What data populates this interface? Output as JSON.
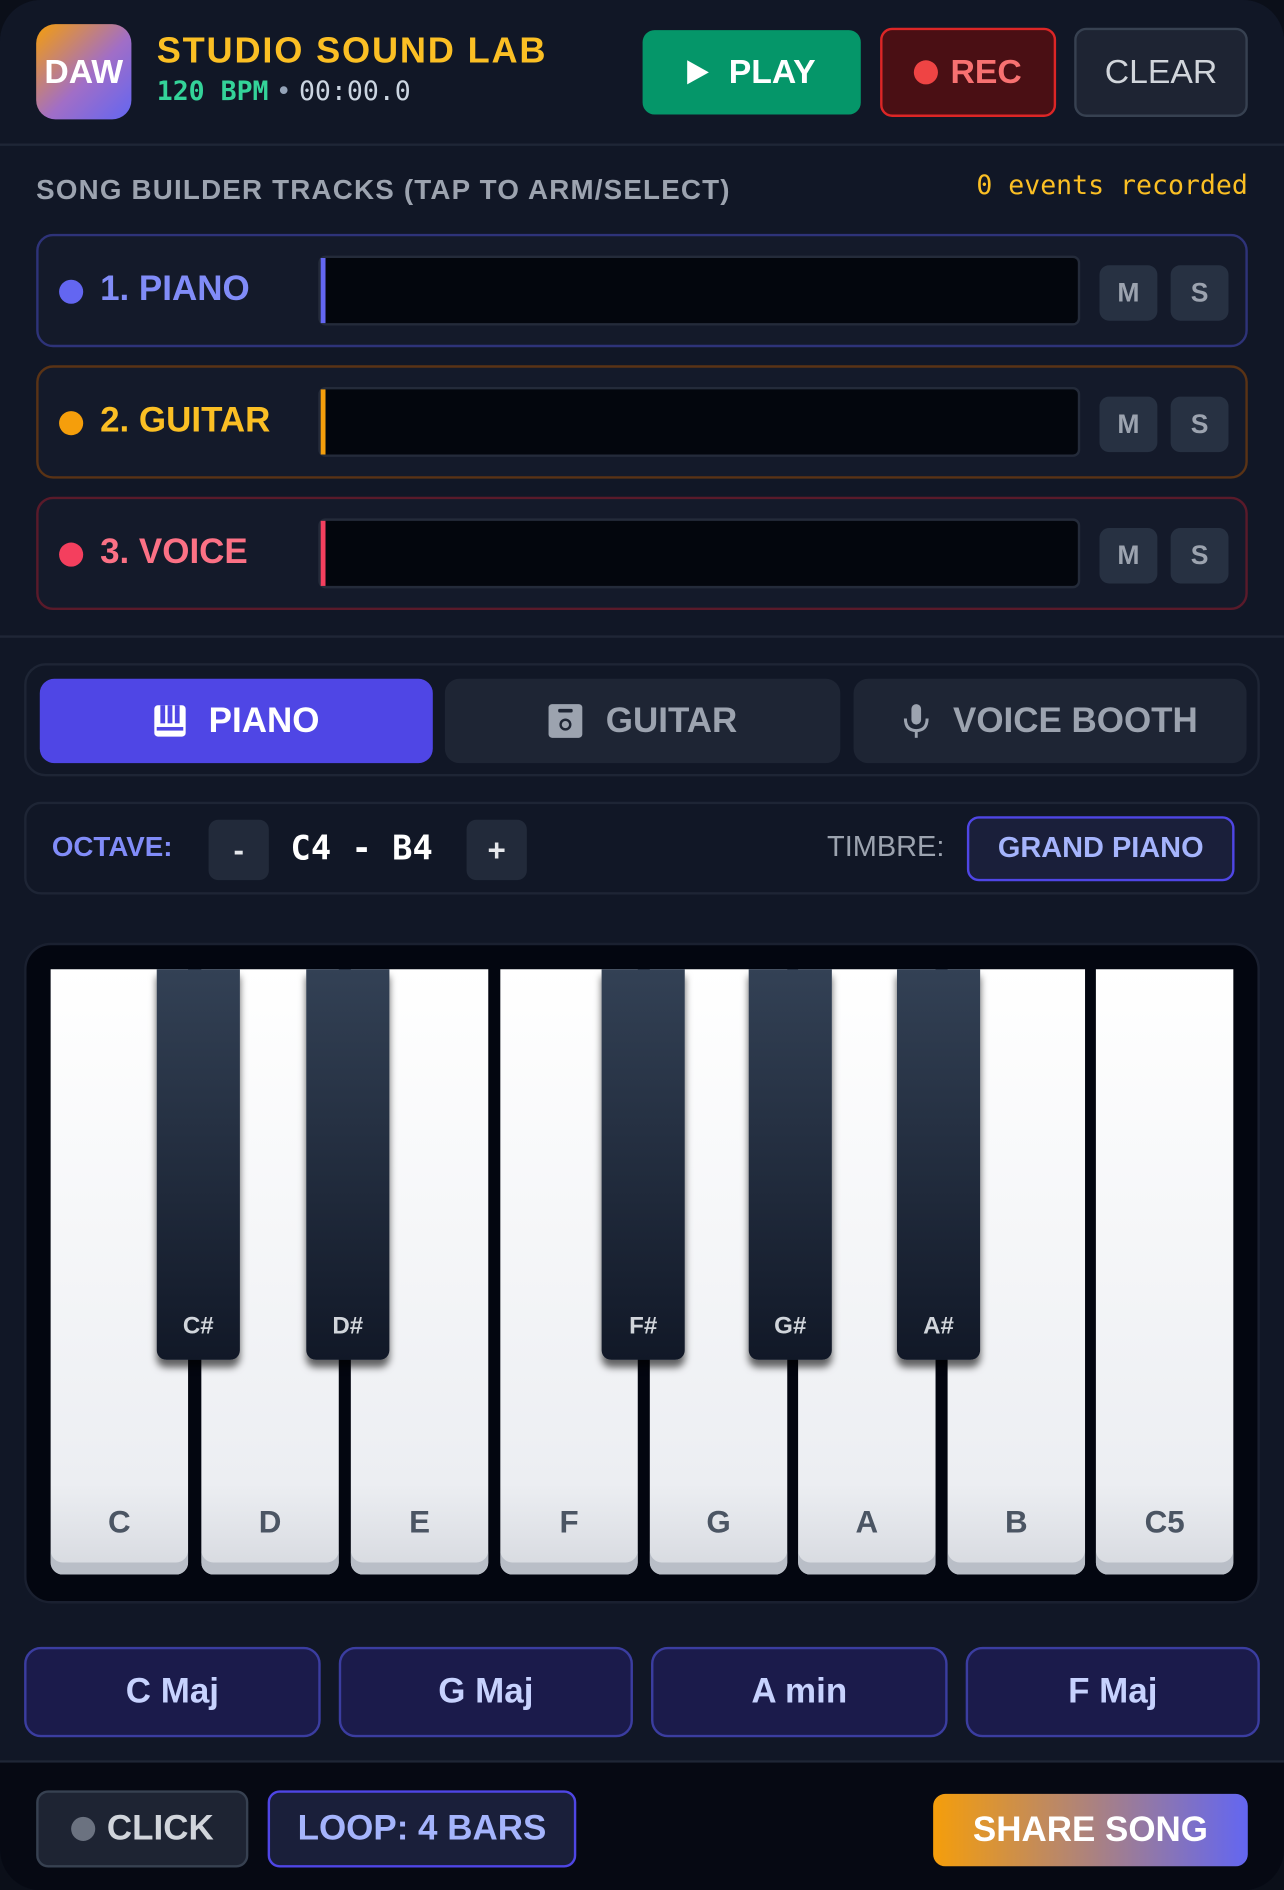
{
  "header": {
    "logo_text": "DAW",
    "title": "STUDIO SOUND LAB",
    "bpm": "120 BPM",
    "separator": "•",
    "time": "00:00.0",
    "play_label": "PLAY",
    "rec_label": "REC",
    "clear_label": "CLEAR"
  },
  "tracks": {
    "heading": "SONG BUILDER TRACKS (TAP TO ARM/SELECT)",
    "events": "0 events recorded",
    "items": [
      {
        "name": "1. PIANO",
        "color": "#6366f1",
        "mute": "M",
        "solo": "S"
      },
      {
        "name": "2. GUITAR",
        "color": "#f59e0b",
        "mute": "M",
        "solo": "S"
      },
      {
        "name": "3. VOICE",
        "color": "#f43f5e",
        "mute": "M",
        "solo": "S"
      }
    ]
  },
  "instrument_tabs": [
    {
      "label": "PIANO",
      "icon": "piano-icon",
      "active": true
    },
    {
      "label": "GUITAR",
      "icon": "guitar-icon",
      "active": false
    },
    {
      "label": "VOICE BOOTH",
      "icon": "microphone-icon",
      "active": false
    }
  ],
  "octave": {
    "label": "OCTAVE:",
    "minus": "-",
    "plus": "+",
    "range": "C4 - B4",
    "timbre_label": "TIMBRE:",
    "timbre_value": "GRAND PIANO"
  },
  "keyboard": {
    "white_keys": [
      "C",
      "D",
      "E",
      "F",
      "G",
      "A",
      "B",
      "C5"
    ],
    "black_keys": [
      "C#",
      "D#",
      "F#",
      "G#",
      "A#"
    ]
  },
  "chords": [
    "C Maj",
    "G Maj",
    "A min",
    "F Maj"
  ],
  "footer": {
    "click_label": "CLICK",
    "loop_label": "LOOP: 4 BARS",
    "share_label": "SHARE SONG"
  },
  "colors": {
    "accent": "#4f46e5",
    "play": "#059669",
    "record": "#ef4444",
    "title": "#fbbf24"
  }
}
